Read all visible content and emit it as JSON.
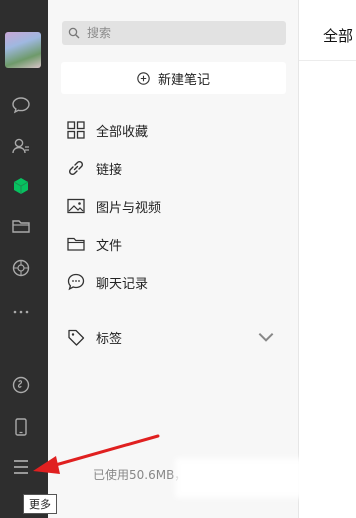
{
  "sidebar": {
    "icons": [
      "chat-icon",
      "contacts-icon",
      "favorites-cube-icon",
      "folder-icon",
      "moments-icon",
      "more-dots-icon",
      "mini-program-icon",
      "phone-icon",
      "menu-icon"
    ],
    "active_color": "#07c160"
  },
  "search": {
    "placeholder": "搜索"
  },
  "new_note": {
    "label": "新建笔记"
  },
  "nav": [
    {
      "label": "全部收藏",
      "icon": "grid-icon"
    },
    {
      "label": "链接",
      "icon": "link-icon"
    },
    {
      "label": "图片与视频",
      "icon": "image-icon"
    },
    {
      "label": "文件",
      "icon": "folder-icon"
    },
    {
      "label": "聊天记录",
      "icon": "chat-record-icon"
    },
    {
      "label": "标签",
      "icon": "tag-icon"
    }
  ],
  "storage": {
    "text": "已使用50.6MB，"
  },
  "content": {
    "title": "全部"
  },
  "tooltip": {
    "text": "更多"
  },
  "annotation": {
    "arrow_color": "#e02020"
  }
}
